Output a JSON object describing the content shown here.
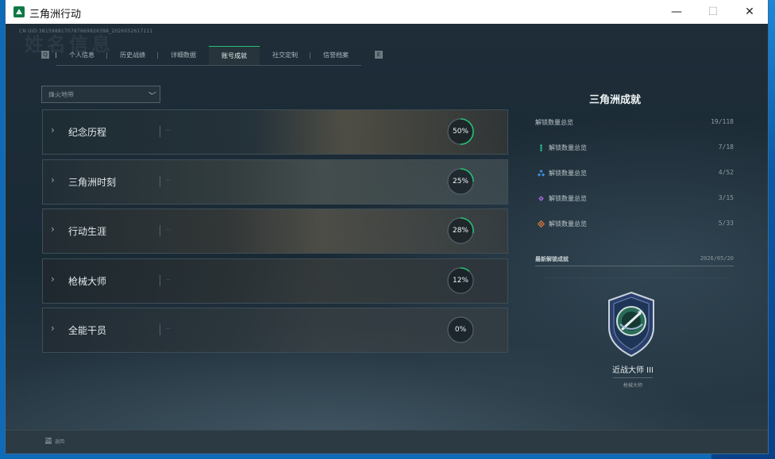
{
  "window": {
    "title": "三角洲行动",
    "minimize": "—",
    "maximize": "☐",
    "close": "✕"
  },
  "header": {
    "uid": "CN UID:3815988170787669826398_2026052617111",
    "watermark": "姓名信息"
  },
  "tabs": [
    {
      "label": "个人信息",
      "active": false
    },
    {
      "label": "历史战绩",
      "active": false
    },
    {
      "label": "详细数据",
      "active": false
    },
    {
      "label": "账号成就",
      "active": true
    },
    {
      "label": "社交定制",
      "active": false
    },
    {
      "label": "信誉档案",
      "active": false
    }
  ],
  "filter": {
    "value": "烽火地带"
  },
  "categories": [
    {
      "label": "纪念历程",
      "progress_text": "50%",
      "progress": 0.5,
      "note": "···"
    },
    {
      "label": "三角洲时刻",
      "progress_text": "25%",
      "progress": 0.25,
      "note": "···"
    },
    {
      "label": "行动生涯",
      "progress_text": "28%",
      "progress": 0.28,
      "note": "···"
    },
    {
      "label": "枪械大师",
      "progress_text": "12%",
      "progress": 0.12,
      "note": "···"
    },
    {
      "label": "全能干员",
      "progress_text": "0%",
      "progress": 0.0,
      "note": "···"
    }
  ],
  "summary": {
    "title": "三角洲成就",
    "total": {
      "label": "解锁数量总览",
      "value": "19/118"
    },
    "tiers": [
      {
        "label": "解锁数量总览",
        "value": "7/18",
        "icon": "green-dots-icon",
        "color": "#2fbf8c"
      },
      {
        "label": "解锁数量总览",
        "value": "4/52",
        "icon": "blue-diamonds-icon",
        "color": "#3c8fe0"
      },
      {
        "label": "解锁数量总览",
        "value": "3/15",
        "icon": "purple-diamonds-icon",
        "color": "#a46ee0"
      },
      {
        "label": "解锁数量总览",
        "value": "5/33",
        "icon": "orange-diamond-icon",
        "color": "#e07a3a"
      }
    ]
  },
  "latest": {
    "label": "最新解锁成就",
    "date": "2026/05/20",
    "medal_name": "近战大师 III",
    "medal_category": "枪械大师"
  },
  "footer": {
    "esc_key": "Esc",
    "esc_label": "返回"
  },
  "colors": {
    "accent_green": "#24c275",
    "panel_dark": "#1b2730"
  }
}
